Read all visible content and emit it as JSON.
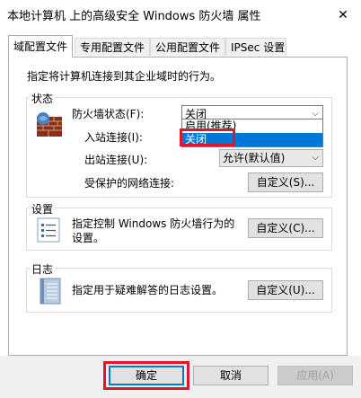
{
  "window": {
    "title": "本地计算机 上的高级安全 Windows 防火墙 属性",
    "close_glyph": "✕"
  },
  "tabs": [
    {
      "label": "域配置文件",
      "active": true
    },
    {
      "label": "专用配置文件",
      "active": false
    },
    {
      "label": "公用配置文件",
      "active": false
    },
    {
      "label": "IPSec 设置",
      "active": false
    }
  ],
  "profile": {
    "description": "指定将计算机连接到其企业域时的行为。"
  },
  "state_group": {
    "title": "状态",
    "icon": "firewall-brick-icon",
    "firewall_state_label": "防火墙状态(F):",
    "firewall_state_value": "关闭",
    "dropdown_options": [
      "启用(推荐)",
      "关闭"
    ],
    "dropdown_selected": "关闭",
    "inbound_label": "入站连接(I):",
    "outbound_label": "出站连接(U):",
    "outbound_value": "允许(默认值)",
    "protected_label": "受保护的网络连接:",
    "customize_label": "自定义(S)..."
  },
  "settings_group": {
    "title": "设置",
    "icon": "settings-list-icon",
    "text_line1": "指定控制 Windows 防火墙行为的",
    "text_line2": "设置。",
    "customize_label": "自定义(C)..."
  },
  "logging_group": {
    "title": "日志",
    "icon": "notebook-icon",
    "text": "指定用于疑难解答的日志设置。",
    "customize_label": "自定义(U)..."
  },
  "footer": {
    "ok_label": "确定",
    "cancel_label": "取消",
    "apply_label": "应用(A)"
  },
  "colors": {
    "accent": "#0078d7",
    "highlight": "#e0142c",
    "face": "#f0f0f0"
  }
}
